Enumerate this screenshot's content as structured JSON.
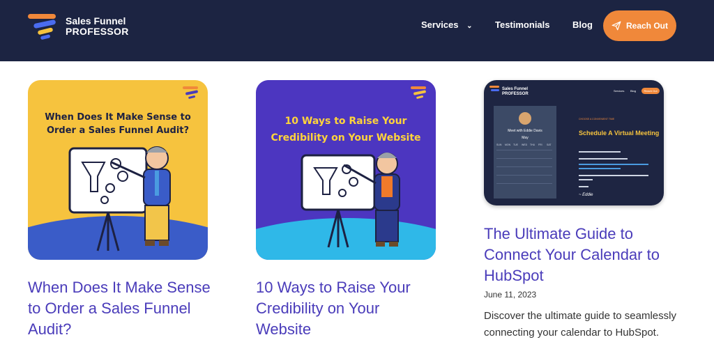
{
  "brand": {
    "line1": "Sales Funnel",
    "line2": "PROFESSOR"
  },
  "nav": {
    "services": "Services",
    "testimonials": "Testimonials",
    "blog": "Blog",
    "cta": "Reach Out"
  },
  "posts": [
    {
      "image_title": "When Does It Make Sense to Order a Sales Funnel Audit?",
      "title": "When Does It Make Sense to Order a Sales Funnel Audit?"
    },
    {
      "image_title": "10 Ways to Raise Your Credibility on Your Website",
      "title": "10 Ways to Raise Your Credibility on Your Website"
    },
    {
      "image": {
        "brand1": "Sales Funnel",
        "brand2": "PROFESSOR",
        "nav_services": "Services",
        "nav_blog": "Blog",
        "nav_cta": "Reach Out",
        "meet": "Meet with Eddie Davis",
        "month": "May",
        "days": [
          "SUN",
          "MON",
          "TUE",
          "WED",
          "THU",
          "FRI",
          "SAT"
        ],
        "kicker": "CHOOSE A CONVENIENT TIME",
        "heading": "Schedule A Virtual Meeting",
        "signoff": "~ Eddie"
      },
      "title": "The Ultimate Guide to Connect Your Calendar to HubSpot",
      "date": "June 11, 2023",
      "excerpt": "Discover the ultimate guide to seamlessly connecting your calendar to HubSpot. Enhance"
    }
  ],
  "colors": {
    "header_bg": "#1c2442",
    "accent": "#f0883a",
    "title": "#4a3cba"
  }
}
